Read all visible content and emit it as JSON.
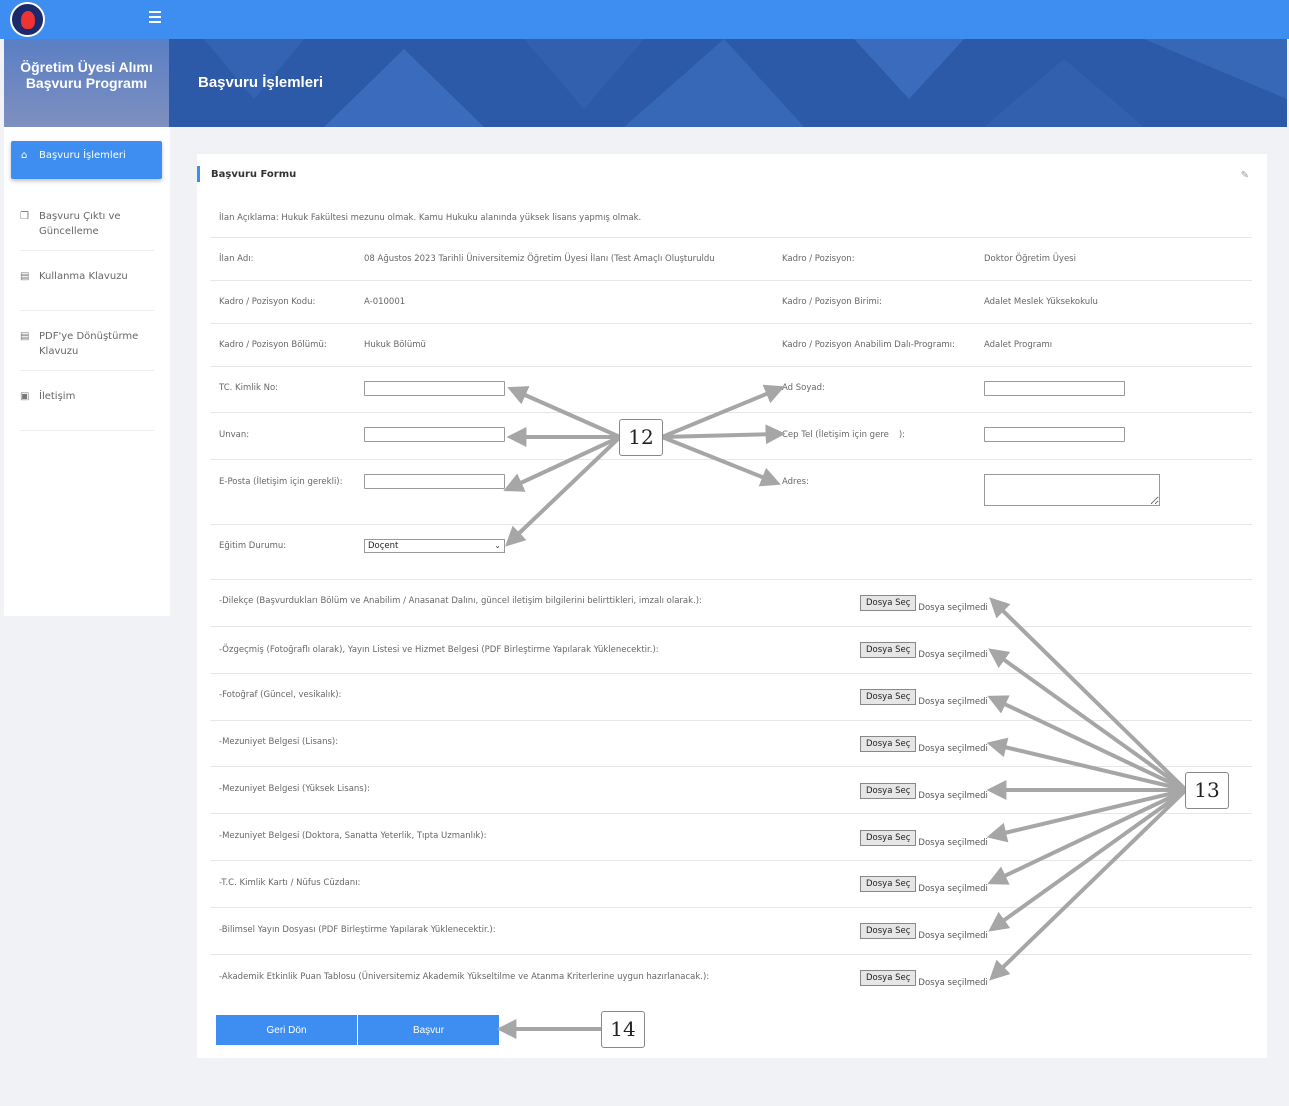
{
  "app": {
    "brand_title": "Öğretim Üyesi Alımı Başvuru Programı",
    "page_heading": "Başvuru İşlemleri"
  },
  "sidebar": {
    "items": [
      {
        "label": "Başvuru İşlemleri",
        "icon": "home-icon",
        "active": true
      },
      {
        "label": "Başvuru Çıktı ve Güncelleme",
        "icon": "copy-icon"
      },
      {
        "label": "Kullanma Klavuzu",
        "icon": "book-icon"
      },
      {
        "label": "PDF'ye Dönüştürme Klavuzu",
        "icon": "book-icon"
      },
      {
        "label": "İletişim",
        "icon": "contact-card-icon"
      }
    ]
  },
  "form": {
    "title": "Başvuru Formu",
    "announcement": "İlan Açıklama: Hukuk Fakültesi mezunu olmak. Kamu Hukuku alanında yüksek lisans yapmış olmak.",
    "info": {
      "ilan_adi_label": "İlan Adı:",
      "ilan_adi_value": "08 Ağustos 2023 Tarihli Üniversitemiz Öğretim Üyesi İlanı (Test Amaçlı Oluşturuldu",
      "kadro_pozisyon_label": "Kadro / Pozisyon:",
      "kadro_pozisyon_value": "Doktor Öğretim Üyesi",
      "kadro_kodu_label": "Kadro / Pozisyon Kodu:",
      "kadro_kodu_value": "A-010001",
      "kadro_birimi_label": "Kadro / Pozisyon Birimi:",
      "kadro_birimi_value": "Adalet Meslek Yüksekokulu",
      "kadro_bolumu_label": "Kadro / Pozisyon Bölümü:",
      "kadro_bolumu_value": "Hukuk Bölümü",
      "kadro_anabilim_label": "Kadro / Pozisyon Anabilim Dalı-Programı:",
      "kadro_anabilim_value": "Adalet Programı"
    },
    "fields": {
      "tc_label": "TC. Kimlik No:",
      "unvan_label": "Unvan:",
      "eposta_label": "E-Posta (İletişim için gerekli):",
      "egitim_label": "Eğitim Durumu:",
      "egitim_value": "Doçent",
      "ad_soyad_label": "Ad Soyad:",
      "cep_tel_label": "Cep Tel (İletişim için gere",
      "cep_tel_label_tail": "):",
      "adres_label": "Adres:"
    },
    "files": [
      "-Dilekçe (Başvurdukları Bölüm ve Anabilim / Anasanat Dalını, güncel iletişim bilgilerini belirttikleri, imzalı olarak.):",
      "-Özgeçmiş (Fotoğraflı olarak), Yayın Listesi ve Hizmet Belgesi (PDF Birleştirme Yapılarak Yüklenecektir.):",
      "-Fotoğraf (Güncel, vesikalık):",
      "-Mezuniyet Belgesi (Lisans):",
      "-Mezuniyet Belgesi (Yüksek Lisans):",
      "-Mezuniyet Belgesi (Doktora, Sanatta Yeterlik, Tıpta Uzmanlık):",
      "-T.C. Kimlik Kartı / Nüfus Cüzdanı:",
      "-Bilimsel Yayın Dosyası (PDF Birleştirme Yapılarak Yüklenecektir.):",
      "-Akademik Etkinlik Puan Tablosu (Üniversitemiz Akademik Yükseltilme ve Atanma Kriterlerine uygun hazırlanacak.):"
    ],
    "file_button_label": "Dosya Seç",
    "file_status": "Dosya seçilmedi",
    "back_button": "Geri Dön",
    "submit_button": "Başvur"
  },
  "callouts": {
    "c12": "12",
    "c13": "13",
    "c14": "14"
  },
  "colors": {
    "primary": "#3d8ef0",
    "banner": "#2c5aa8",
    "arrow": "#a6a6a6"
  }
}
